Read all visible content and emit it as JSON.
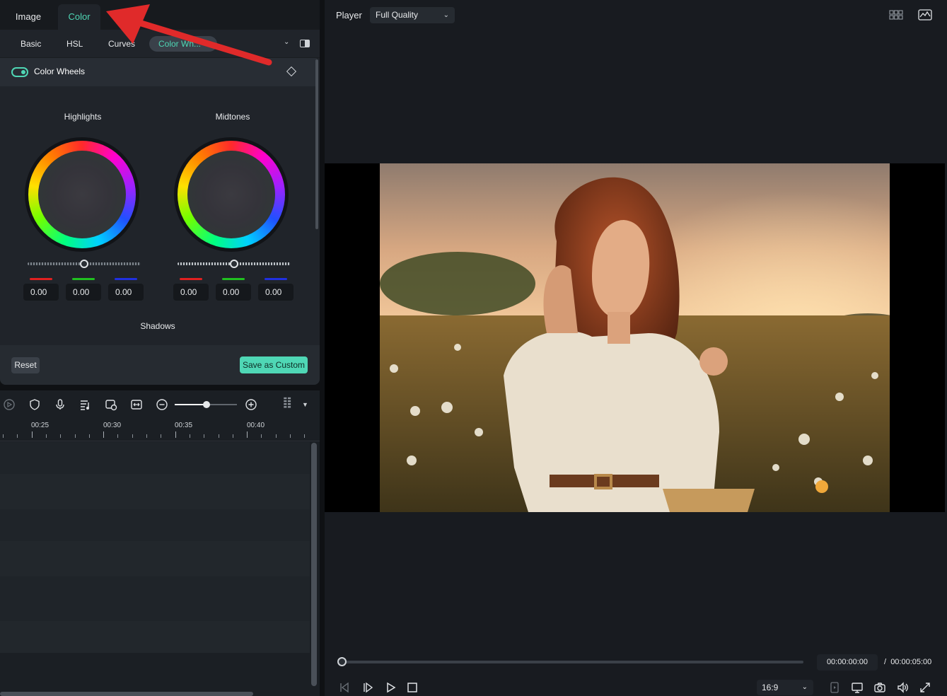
{
  "tabs": {
    "image": "Image",
    "color": "Color"
  },
  "subtabs": {
    "basic": "Basic",
    "hsl": "HSL",
    "curves": "Curves",
    "color_wheels": "Color Wh..."
  },
  "section": {
    "title": "Color Wheels",
    "toggle_on": true
  },
  "wheels": {
    "highlights": {
      "label": "Highlights",
      "r": "0.00",
      "g": "0.00",
      "b": "0.00"
    },
    "midtones": {
      "label": "Midtones",
      "r": "0.00",
      "g": "0.00",
      "b": "0.00"
    },
    "shadows": {
      "label": "Shadows"
    }
  },
  "actions": {
    "reset": "Reset",
    "save": "Save as Custom"
  },
  "timeline": {
    "ruler": [
      "00:25",
      "00:30",
      "00:35",
      "00:40"
    ],
    "zoom_level": 0.5
  },
  "player": {
    "title": "Player",
    "quality": "Full Quality",
    "current_time": "00:00:00:00",
    "separator": "/",
    "total_time": "00:00:05:00",
    "aspect_ratio": "16:9",
    "progress": 0
  },
  "colors": {
    "accent": "#4fd7b5",
    "red": "#e02020",
    "green": "#20c020",
    "blue": "#2030e0",
    "arrow": "#e02a2a"
  }
}
